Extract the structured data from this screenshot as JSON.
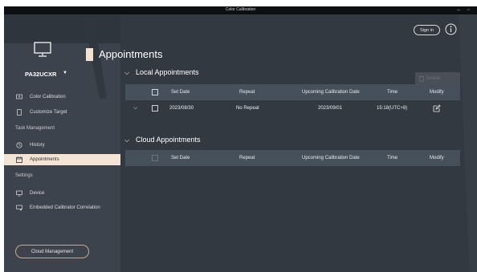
{
  "window": {
    "title": "Color Calibration",
    "minimize_glyph": "–",
    "restore_glyph": "▫"
  },
  "header": {
    "signin_label": "Sign in",
    "info_icon": "info-icon"
  },
  "sidebar": {
    "device_name": "PA32UCXR",
    "device_caret": "▼",
    "items_top": [
      {
        "label": "Color Calibration",
        "icon": "monitor-calibration-icon"
      },
      {
        "label": "Customize Target",
        "icon": "target-icon"
      }
    ],
    "task_section": "Task Management",
    "items_task": [
      {
        "label": "History",
        "icon": "history-icon"
      },
      {
        "label": "Appointments",
        "icon": "calendar-icon",
        "active": true
      }
    ],
    "settings_section": "Settings",
    "items_settings": [
      {
        "label": "Device",
        "icon": "device-icon"
      },
      {
        "label": "Embedded Calibrator Correlation",
        "icon": "calibrator-icon"
      }
    ],
    "cloud_button": "Cloud Management"
  },
  "main": {
    "title": "Appointments",
    "local": {
      "heading": "Local Appointments",
      "delete_label": "Delete",
      "columns": [
        "Set Date",
        "Repeat",
        "Upcoming Calibration Date",
        "Time",
        "Modify"
      ],
      "rows": [
        {
          "set_date": "2023/08/30",
          "repeat": "No Repeat",
          "upcoming": "2023/09/01",
          "time": "15:18(UTC+8)"
        }
      ]
    },
    "cloud": {
      "heading": "Cloud Appointments",
      "columns": [
        "Set Date",
        "Repeat",
        "Upcoming Calibration Date",
        "Time",
        "Modify"
      ]
    }
  },
  "colors": {
    "background": "#333941",
    "sidebar": "#3d434c",
    "accent": "#f3e1d2",
    "table_header": "#46505b"
  }
}
